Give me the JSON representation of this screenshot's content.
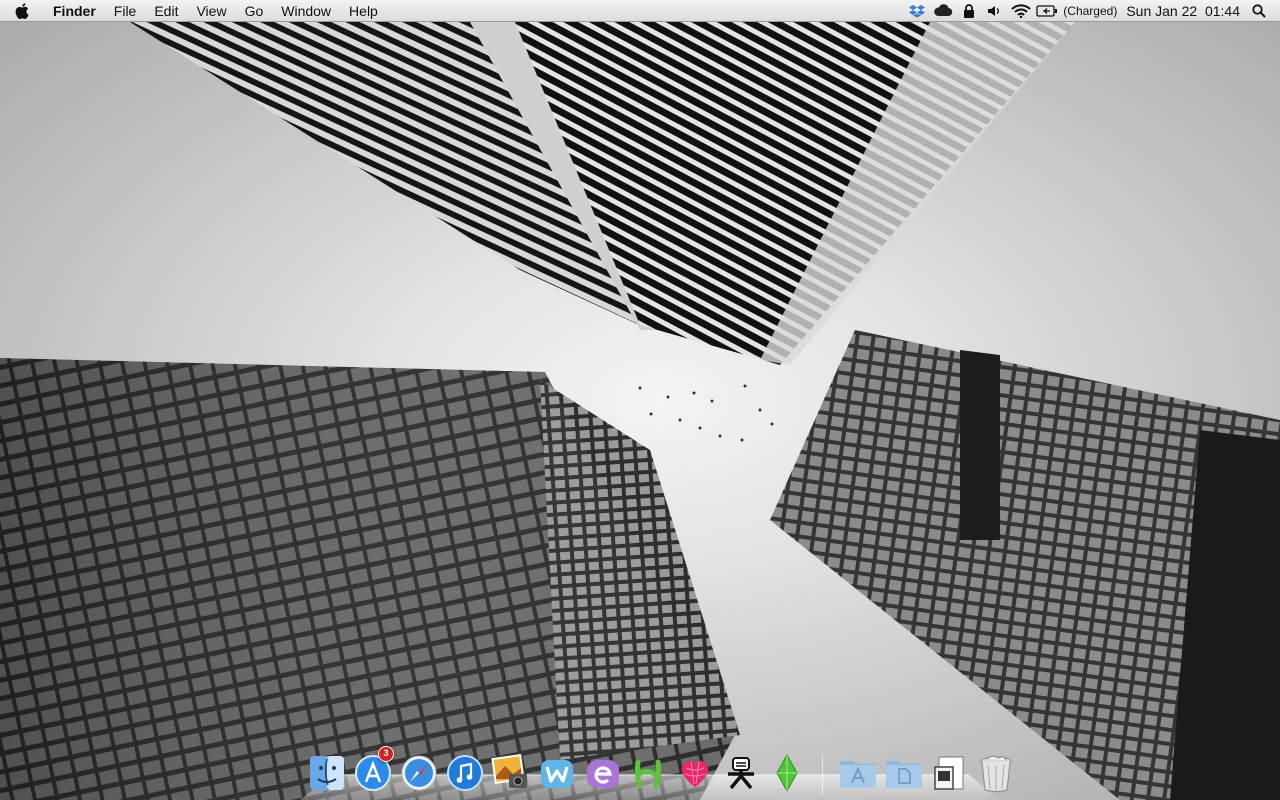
{
  "menubar": {
    "app_name": "Finder",
    "menus": [
      "File",
      "Edit",
      "View",
      "Go",
      "Window",
      "Help"
    ],
    "status_icons": [
      "dropbox-icon",
      "icloud-icon",
      "lock-icon",
      "volume-icon",
      "wifi-icon",
      "battery-icon"
    ],
    "battery_status": "(Charged)",
    "date": "Sun Jan 22",
    "time": "01:44"
  },
  "dock": {
    "apps": [
      {
        "name": "finder-icon",
        "running": true
      },
      {
        "name": "app-store-icon",
        "running": false,
        "badge": "3"
      },
      {
        "name": "safari-icon",
        "running": false
      },
      {
        "name": "itunes-icon",
        "running": false
      },
      {
        "name": "iphoto-icon",
        "running": false
      },
      {
        "name": "app-w-icon",
        "running": false
      },
      {
        "name": "app-e-icon",
        "running": false
      },
      {
        "name": "app-h-icon",
        "running": false
      },
      {
        "name": "heart-app-icon",
        "running": false
      },
      {
        "name": "character-app-icon",
        "running": false
      },
      {
        "name": "sims-icon",
        "running": false
      }
    ],
    "stacks": [
      "applications-folder-icon",
      "documents-folder-icon",
      "preview-file-icon",
      "trash-icon"
    ]
  }
}
